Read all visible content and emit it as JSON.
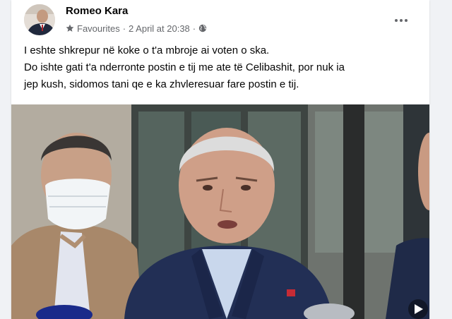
{
  "post": {
    "author": "Romeo Kara",
    "audience": "Favourites",
    "separator": "·",
    "timestamp": "2 April at 20:38",
    "text_lines": [
      "I eshte shkrepur në koke o t'a mbroje ai voten o ska.",
      "Do ishte gati t'a nderronte postin e tij me ate të Celibashit, por nuk ia",
      "jep kush, sidomos tani qe e ka zhvleresuar fare postin e tij."
    ]
  },
  "icons": {
    "audience": "star-icon",
    "privacy": "globe-icon",
    "menu": "more-options-icon"
  },
  "colors": {
    "background": "#f0f2f5",
    "card": "#ffffff",
    "name": "#050505",
    "meta": "#65676b"
  }
}
